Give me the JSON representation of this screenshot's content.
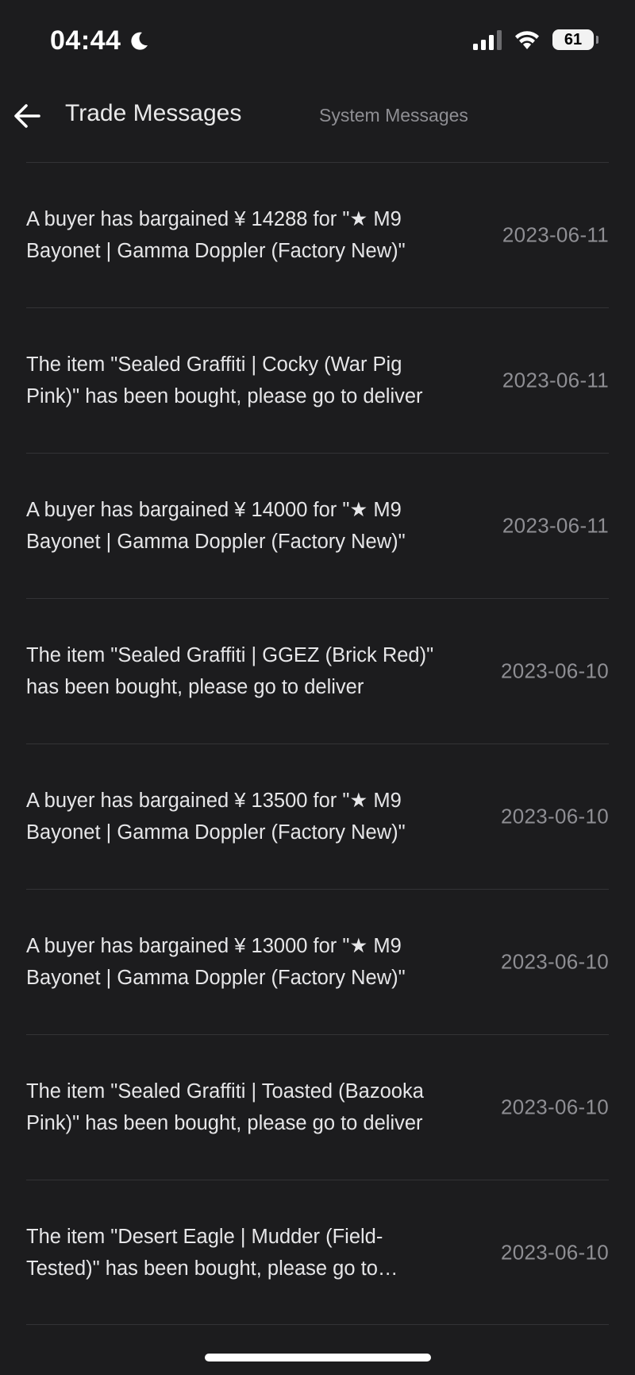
{
  "status_bar": {
    "time": "04:44",
    "battery": "61"
  },
  "header": {
    "back_icon": "arrow-left-icon",
    "title": "Trade Messages",
    "tab_system": "System Messages"
  },
  "messages": [
    {
      "text": "A buyer has bargained ¥ 14288 for \"★ M9 Bayonet | Gamma Doppler (Factory New)\"",
      "date": "2023-06-11"
    },
    {
      "text": "The item \"Sealed Graffiti | Cocky (War Pig Pink)\" has been bought, please go to deliver",
      "date": "2023-06-11"
    },
    {
      "text": "A buyer has bargained ¥ 14000 for \"★ M9 Bayonet | Gamma Doppler (Factory New)\"",
      "date": "2023-06-11"
    },
    {
      "text": "The item \"Sealed Graffiti | GGEZ (Brick Red)\" has been bought, please go to deliver",
      "date": "2023-06-10"
    },
    {
      "text": "A buyer has bargained ¥ 13500 for \"★ M9 Bayonet | Gamma Doppler (Factory New)\"",
      "date": "2023-06-10"
    },
    {
      "text": "A buyer has bargained ¥ 13000 for \"★ M9 Bayonet | Gamma Doppler (Factory New)\"",
      "date": "2023-06-10"
    },
    {
      "text": "The item \"Sealed Graffiti | Toasted (Bazooka Pink)\" has been bought, please go to deliver",
      "date": "2023-06-10"
    },
    {
      "text": "The item \"Desert Eagle | Mudder (Field-Tested)\" has been bought, please go to deliver",
      "date": "2023-06-10"
    }
  ]
}
